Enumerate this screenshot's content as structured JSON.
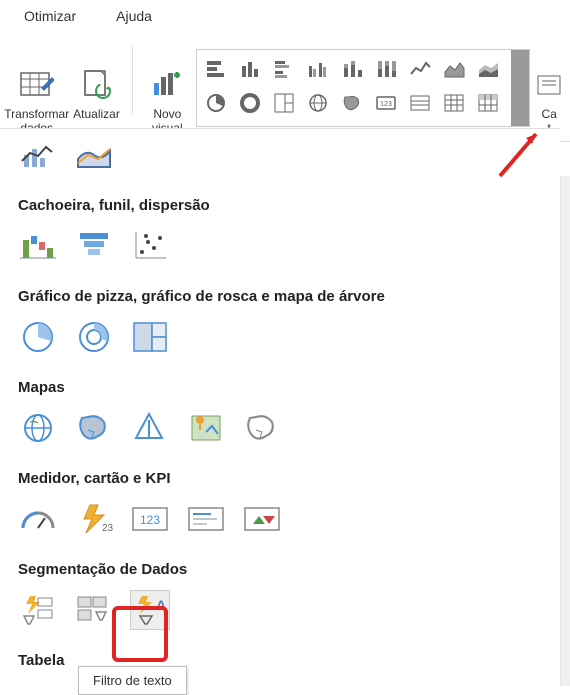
{
  "menu": {
    "optimize": "Otimizar",
    "help": "Ajuda"
  },
  "ribbon": {
    "transform": "Transformar\ndados",
    "update": "Atualizar",
    "newvisual": "Novo\nvisual",
    "rightgroup": "Ca\nt"
  },
  "categories": {
    "previous_trailing": "",
    "cat1": "Cachoeira, funil, dispersão",
    "cat2": "Gráfico de pizza, gráfico de rosca e mapa de árvore",
    "cat3": "Mapas",
    "cat4": "Medidor, cartão e KPI",
    "cat5": "Segmentação de Dados",
    "cat6": "Tabela"
  },
  "tooltip": "Filtro de texto"
}
